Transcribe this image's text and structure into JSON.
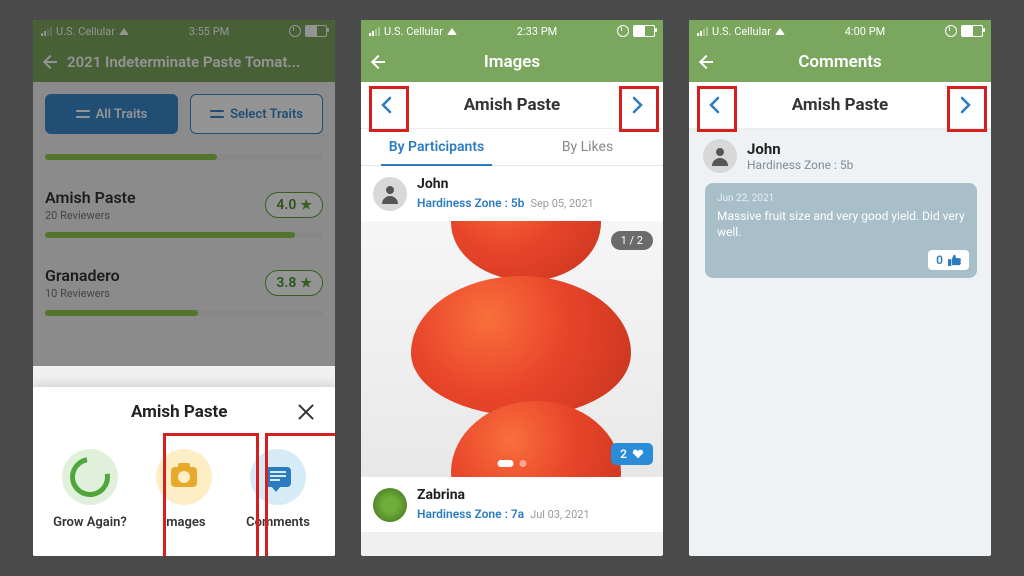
{
  "screen1": {
    "status": {
      "carrier": "U.S. Cellular",
      "time": "3:55 PM"
    },
    "header_title": "2021 Indeterminate Paste Tomat...",
    "buttons": {
      "all_traits": "All Traits",
      "select_traits": "Select Traits"
    },
    "varieties": [
      {
        "name": "Amish Paste",
        "sub": "20 Reviewers",
        "rating": "4.0",
        "progress": 90
      },
      {
        "name": "Granadero",
        "sub": "10 Reviewers",
        "rating": "3.8",
        "progress": 55
      }
    ],
    "sheet": {
      "title": "Amish Paste",
      "actions": {
        "grow": "Grow Again?",
        "images": "Images",
        "comments": "Comments"
      }
    }
  },
  "screen2": {
    "status": {
      "carrier": "U.S. Cellular",
      "time": "2:33 PM"
    },
    "header_title": "Images",
    "item_label": "Amish Paste",
    "tabs": {
      "participants": "By Participants",
      "likes": "By Likes"
    },
    "posts": [
      {
        "name": "John",
        "zone": "Hardiness Zone : 5b",
        "date": "Sep 05, 2021",
        "page": "1 / 2",
        "hearts": "2"
      },
      {
        "name": "Zabrina",
        "zone": "Hardiness Zone : 7a",
        "date": "Jul 03, 2021"
      }
    ]
  },
  "screen3": {
    "status": {
      "carrier": "U.S. Cellular",
      "time": "4:00 PM"
    },
    "header_title": "Comments",
    "item_label": "Amish Paste",
    "comment": {
      "name": "John",
      "zone": "Hardiness Zone : 5b",
      "date": "Jun 22, 2021",
      "text": "Massive fruit size and very good yield. Did very well.",
      "likes": "0"
    }
  }
}
